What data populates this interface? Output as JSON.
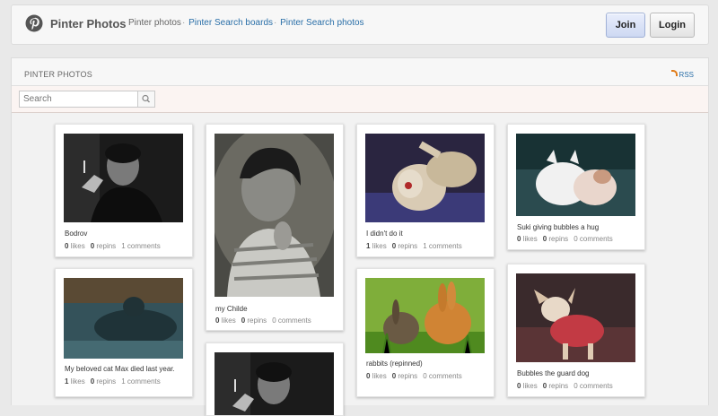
{
  "app": {
    "title": "Pinter Photos"
  },
  "nav": {
    "current": "Pinter photos",
    "links": [
      "Pinter Search boards",
      "Pinter Search photos"
    ]
  },
  "header": {
    "join_label": "Join",
    "login_label": "Login"
  },
  "section": {
    "title": "PINTER PHOTOS",
    "rss_label": "RSS"
  },
  "search": {
    "placeholder": "Search"
  },
  "stat_labels": {
    "likes": "likes",
    "repins": "repins",
    "comments": "comments"
  },
  "pins": [
    {
      "caption": "Bodrov",
      "likes": "0",
      "repins": "0",
      "comments": "1"
    },
    {
      "caption": "My beloved cat Max died last year.",
      "likes": "1",
      "repins": "0",
      "comments": "1"
    },
    {
      "caption": "my Childe",
      "likes": "0",
      "repins": "0",
      "comments": "0"
    },
    {
      "caption": "I didn't do it",
      "likes": "1",
      "repins": "0",
      "comments": "1"
    },
    {
      "caption": "rabbits (repinned)",
      "likes": "0",
      "repins": "0",
      "comments": "0"
    },
    {
      "caption": "Suki giving bubbles a hug",
      "likes": "0",
      "repins": "0",
      "comments": "0"
    },
    {
      "caption": "Bubbles the guard dog",
      "likes": "0",
      "repins": "0",
      "comments": "0"
    }
  ],
  "colors": {
    "accent": "#2a6fa8",
    "rss": "#e07b18",
    "join_bg": "#dfe7fb"
  }
}
